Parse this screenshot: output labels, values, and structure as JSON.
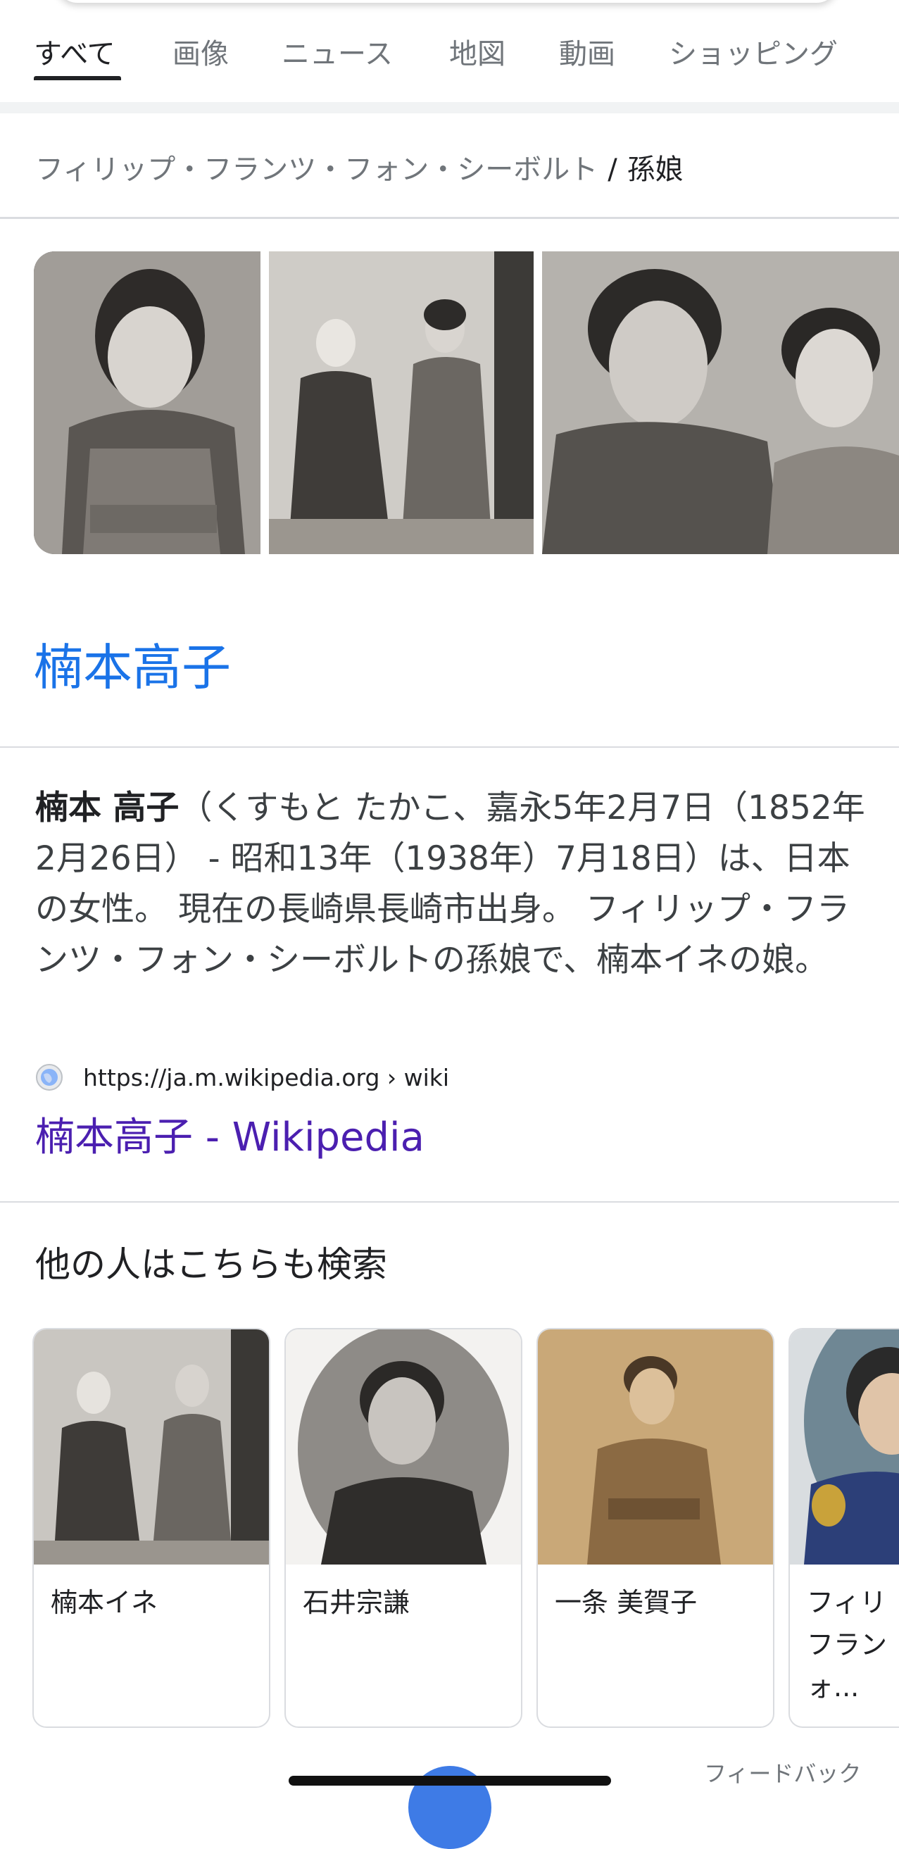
{
  "tabs": [
    {
      "label": "すべて",
      "active": true
    },
    {
      "label": "画像"
    },
    {
      "label": "ニュース"
    },
    {
      "label": "地図"
    },
    {
      "label": "動画"
    },
    {
      "label": "ショッピング"
    }
  ],
  "breadcrumb": {
    "parent": "フィリップ・フランツ・フォン・シーボルト",
    "separator": "/",
    "current": "孫娘"
  },
  "images": [
    {
      "icon": "portrait-photo-woman-kimono"
    },
    {
      "icon": "photo-two-women-seated"
    },
    {
      "icon": "photo-man-and-woman"
    }
  ],
  "entity": {
    "title": "楠本高子",
    "desc_bold": "楠本 高子",
    "desc_rest": "（くすもと たかこ、嘉永5年2月7日（1852年2月26日） - 昭和13年（1938年）7月18日）は、日本の女性。 現在の長崎県長崎市出身。 フィリップ・フランツ・フォン・シーボルトの孫娘で、楠本イネの娘。",
    "source_url": "https://ja.m.wikipedia.org › wiki",
    "source_link": "楠本高子 - Wikipedia"
  },
  "related": {
    "heading": "他の人はこちらも検索",
    "cards": [
      {
        "name": "楠本イネ"
      },
      {
        "name": "石井宗謙"
      },
      {
        "name": "一条 美賀子"
      },
      {
        "name": "フィリ\nフラン\nォ..."
      }
    ]
  },
  "footer": {
    "feedback": "フィードバック"
  },
  "colors": {
    "link_blue": "#1a73e8",
    "visited_purple": "#4b1fb0",
    "text_gray": "#70757a"
  }
}
